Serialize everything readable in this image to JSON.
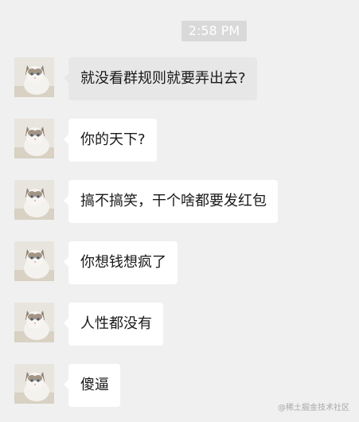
{
  "timestamp": "2:58 PM",
  "messages": [
    {
      "text": "就没看群规则就要弄出去?"
    },
    {
      "text": "你的天下?"
    },
    {
      "text": "搞不搞笑，干个啥都要发红包"
    },
    {
      "text": "你想钱想疯了"
    },
    {
      "text": "人性都没有"
    },
    {
      "text": "傻逼"
    }
  ],
  "watermark": "@稀土掘金技术社区",
  "colors": {
    "background": "#f0f0f0",
    "bubble": "#ffffff",
    "bubble_highlight": "#e7e7e7",
    "time_badge": "#d9d9d9"
  }
}
